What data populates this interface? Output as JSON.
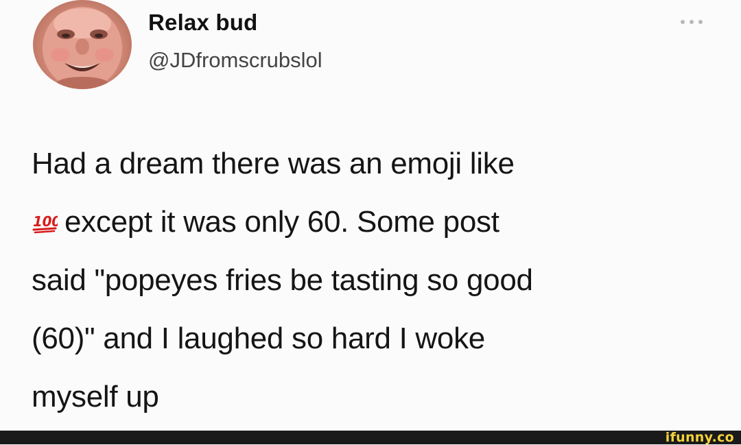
{
  "tweet": {
    "author": {
      "display_name": "Relax bud",
      "handle": "@JDfromscrubslol",
      "avatar_icon": "profile-photo"
    },
    "more_icon": "more-options-icon",
    "body_lines": [
      "Had a dream there was an emoji like",
      "except it was only 60. Some post",
      "said \"popeyes fries be tasting so good",
      "(60)\" and I laughed so hard I woke",
      "myself up"
    ],
    "inline_emoji": {
      "name": "hundred-points-emoji",
      "text": "100",
      "color": "#d81b1b"
    }
  },
  "footer": {
    "watermark": "ifunny.co",
    "watermark_color": "#f4d23a",
    "bar_color": "#1a1a1a"
  }
}
